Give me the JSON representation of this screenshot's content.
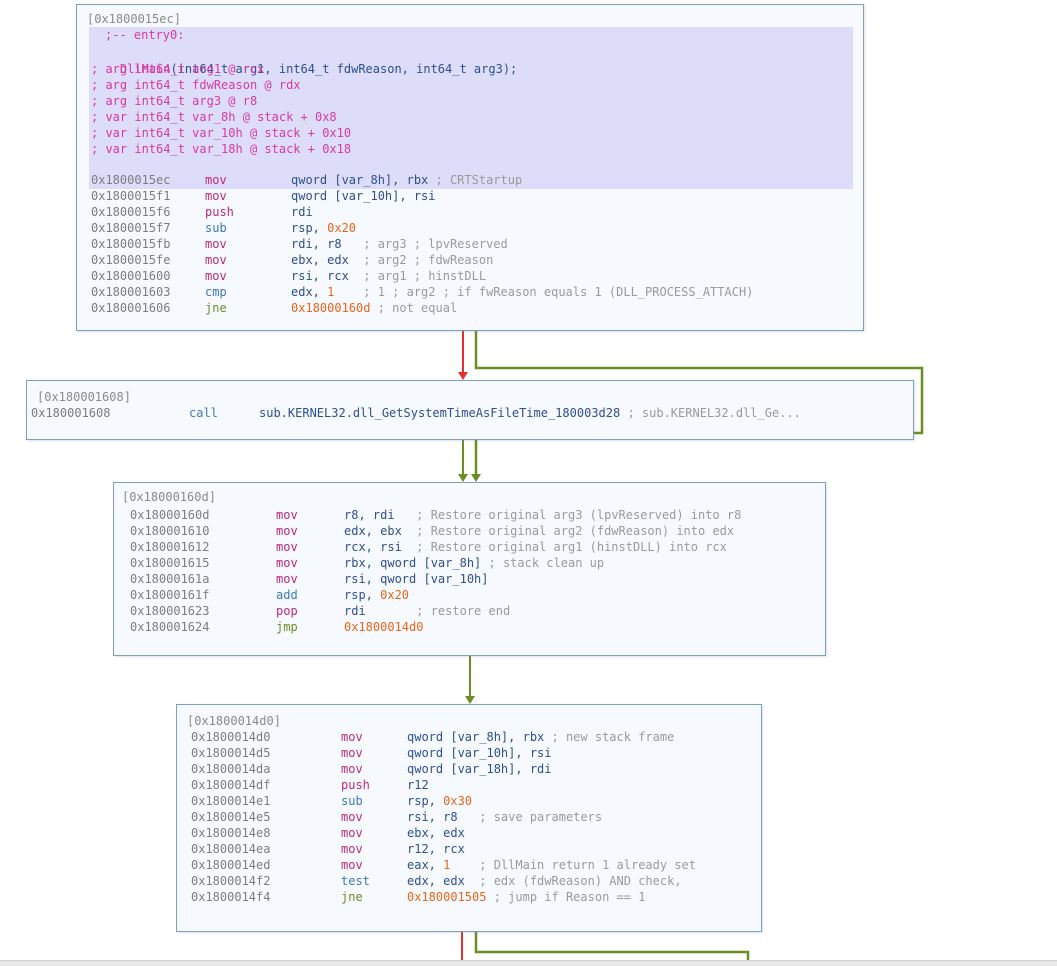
{
  "block1": {
    "header": "[0x1800015ec]",
    "entry": ";-- entry0:",
    "signature_name": "DllMain",
    "signature_rest": "(int64_t arg1, int64_t fdwReason, int64_t arg3);",
    "decls": [
      "; arg int64_t arg1 @ rcx",
      "; arg int64_t fdwReason @ rdx",
      "; arg int64_t arg3 @ r8",
      "; var int64_t var_8h @ stack + 0x8",
      "; var int64_t var_10h @ stack + 0x10",
      "; var int64_t var_18h @ stack + 0x18"
    ],
    "rows": [
      {
        "addr": "0x1800015ec",
        "mn": "mov",
        "op": "qword [var_8h], rbx",
        "num": "",
        "tail": " ; CRTStartup"
      },
      {
        "addr": "0x1800015f1",
        "mn": "mov",
        "op": "qword [var_10h], rsi",
        "num": "",
        "tail": ""
      },
      {
        "addr": "0x1800015f6",
        "mn": "push",
        "op": "rdi",
        "num": "",
        "tail": ""
      },
      {
        "addr": "0x1800015f7",
        "mn": "sub",
        "op": "rsp, ",
        "num": "0x20",
        "tail": ""
      },
      {
        "addr": "0x1800015fb",
        "mn": "mov",
        "op": "rdi, r8",
        "num": "",
        "tail": "   ; arg3 ; lpvReserved"
      },
      {
        "addr": "0x1800015fe",
        "mn": "mov",
        "op": "ebx, edx",
        "num": "",
        "tail": "  ; arg2 ; fdwReason"
      },
      {
        "addr": "0x180001600",
        "mn": "mov",
        "op": "rsi, rcx",
        "num": "",
        "tail": "  ; arg1 ; hinstDLL"
      },
      {
        "addr": "0x180001603",
        "mn": "cmp",
        "op": "edx, ",
        "num": "1",
        "tail": "    ; 1 ; arg2 ; if fwReason equals 1 (DLL_PROCESS_ATTACH)"
      },
      {
        "addr": "0x180001606",
        "mn": "jne",
        "op": "",
        "num": "0x18000160d",
        "tail": " ; not equal"
      }
    ]
  },
  "block2": {
    "header": "[0x180001608]",
    "rows": [
      {
        "addr": "0x180001608",
        "mn": "call",
        "op": "sub.KERNEL32.dll_GetSystemTimeAsFileTime_180003d28",
        "num": "",
        "tail": " ; sub.KERNEL32.dll_Ge..."
      }
    ]
  },
  "block3": {
    "header": "[0x18000160d]",
    "rows": [
      {
        "addr": "0x18000160d",
        "mn": "mov",
        "op": "r8, rdi",
        "num": "",
        "tail": "   ; Restore original arg3 (lpvReserved) into r8"
      },
      {
        "addr": "0x180001610",
        "mn": "mov",
        "op": "edx, ebx",
        "num": "",
        "tail": "  ; Restore original arg2 (fdwReason) into edx"
      },
      {
        "addr": "0x180001612",
        "mn": "mov",
        "op": "rcx, rsi",
        "num": "",
        "tail": "  ; Restore original arg1 (hinstDLL) into rcx"
      },
      {
        "addr": "0x180001615",
        "mn": "mov",
        "op": "rbx, qword [var_8h]",
        "num": "",
        "tail": " ; stack clean up"
      },
      {
        "addr": "0x18000161a",
        "mn": "mov",
        "op": "rsi, qword [var_10h]",
        "num": "",
        "tail": ""
      },
      {
        "addr": "0x18000161f",
        "mn": "add",
        "op": "rsp, ",
        "num": "0x20",
        "tail": ""
      },
      {
        "addr": "0x180001623",
        "mn": "pop",
        "op": "rdi",
        "num": "",
        "tail": "       ; restore end"
      },
      {
        "addr": "0x180001624",
        "mn": "jmp",
        "op": "",
        "num": "0x1800014d0",
        "tail": ""
      }
    ]
  },
  "block4": {
    "header": "[0x1800014d0]",
    "rows": [
      {
        "addr": "0x1800014d0",
        "mn": "mov",
        "op": "qword [var_8h], rbx",
        "num": "",
        "tail": " ; new stack frame"
      },
      {
        "addr": "0x1800014d5",
        "mn": "mov",
        "op": "qword [var_10h], rsi",
        "num": "",
        "tail": ""
      },
      {
        "addr": "0x1800014da",
        "mn": "mov",
        "op": "qword [var_18h], rdi",
        "num": "",
        "tail": ""
      },
      {
        "addr": "0x1800014df",
        "mn": "push",
        "op": "r12",
        "num": "",
        "tail": ""
      },
      {
        "addr": "0x1800014e1",
        "mn": "sub",
        "op": "rsp, ",
        "num": "0x30",
        "tail": ""
      },
      {
        "addr": "0x1800014e5",
        "mn": "mov",
        "op": "rsi, r8",
        "num": "",
        "tail": "   ; save parameters"
      },
      {
        "addr": "0x1800014e8",
        "mn": "mov",
        "op": "ebx, edx",
        "num": "",
        "tail": ""
      },
      {
        "addr": "0x1800014ea",
        "mn": "mov",
        "op": "r12, rcx",
        "num": "",
        "tail": ""
      },
      {
        "addr": "0x1800014ed",
        "mn": "mov",
        "op": "eax, ",
        "num": "1",
        "tail": "    ; DllMain return 1 already set"
      },
      {
        "addr": "0x1800014f2",
        "mn": "test",
        "op": "edx, edx",
        "num": "",
        "tail": "  ; edx (fdwReason) AND check,"
      },
      {
        "addr": "0x1800014f4",
        "mn": "jne",
        "op": "",
        "num": "0x180001505",
        "tail": " ; jump if Reason == 1"
      }
    ]
  },
  "colors": {
    "edge_true": "#6b8e23",
    "edge_false": "#e53030",
    "edge_uncond": "#6b8e23",
    "block_border": "#7f9fc0",
    "highlight": "#ddddfa"
  }
}
